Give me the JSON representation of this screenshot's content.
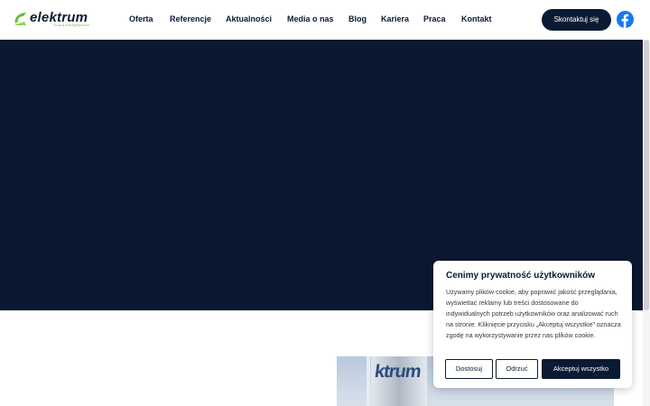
{
  "header": {
    "logo_name": "elektrum",
    "logo_tagline": "Grupa energetyczna",
    "nav": [
      {
        "label": "Oferta"
      },
      {
        "label": "Referencje"
      },
      {
        "label": "Aktualności"
      },
      {
        "label": "Media o nas"
      },
      {
        "label": "Blog"
      },
      {
        "label": "Kariera"
      },
      {
        "label": "Praca"
      },
      {
        "label": "Kontakt"
      }
    ],
    "cta_label": "Skontaktuj się",
    "social_icon": "facebook-icon"
  },
  "photo": {
    "flag_text": "ktrum"
  },
  "cookie": {
    "title": "Cenimy prywatność użytkowników",
    "text": "Używamy plików cookie, aby poprawić jakość przeglądania, wyświetlać reklamy lub treści dostosowane do indywidualnych potrzeb użytkowników oraz analizować ruch na stronie. Kliknięcie przycisku „Akceptuj wszystkie” oznacza zgodę na wykorzystywanie przez nas plików cookie.",
    "btn_customize": "Dostosuj",
    "btn_reject": "Odrzuć",
    "btn_accept": "Akceptuj wszystko"
  },
  "colors": {
    "navy": "#0b1a33",
    "hero": "#0c1731",
    "brand_green": "#6bbf3a",
    "facebook": "#1877f2"
  }
}
